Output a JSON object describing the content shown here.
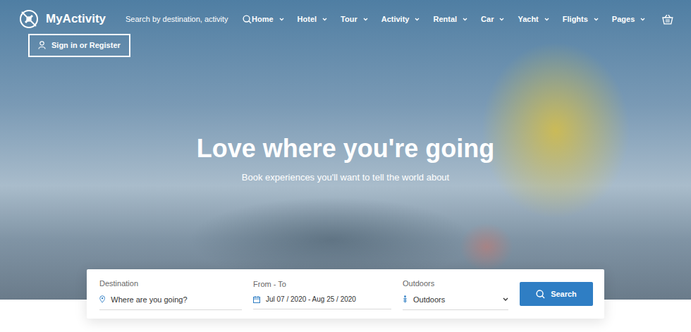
{
  "brand": {
    "name": "MyActivity"
  },
  "header_search": {
    "placeholder": "Search by destination, activity"
  },
  "nav": [
    {
      "label": "Home"
    },
    {
      "label": "Hotel"
    },
    {
      "label": "Tour"
    },
    {
      "label": "Activity"
    },
    {
      "label": "Rental"
    },
    {
      "label": "Car"
    },
    {
      "label": "Yacht"
    },
    {
      "label": "Flights"
    },
    {
      "label": "Pages"
    }
  ],
  "sign_in": {
    "label": "Sign in or Register"
  },
  "hero": {
    "title": "Love where you're going",
    "subtitle": "Book experiences you'll want to tell the world about"
  },
  "search_form": {
    "destination": {
      "label": "Destination",
      "placeholder": "Where are you going?"
    },
    "dates": {
      "label": "From - To",
      "value": "Jul 07 / 2020 - Aug 25 / 2020"
    },
    "category": {
      "label": "Outdoors",
      "value": "Outdoors"
    },
    "button": "Search"
  }
}
